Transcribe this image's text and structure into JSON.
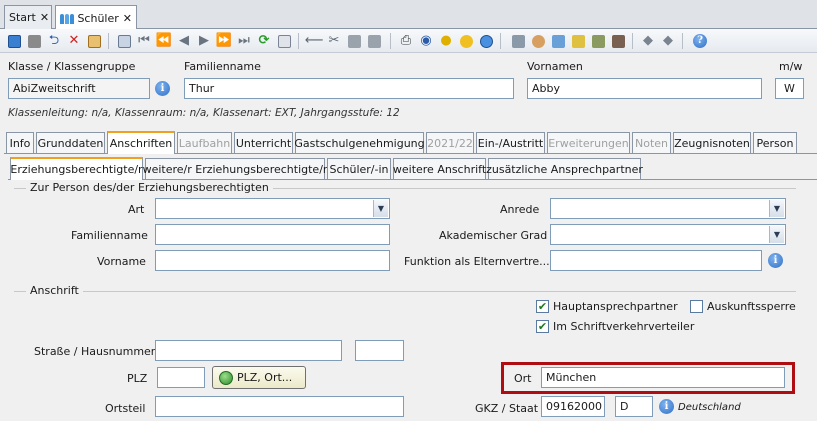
{
  "doc_tabs": [
    {
      "label": "Start",
      "active": false
    },
    {
      "label": "Schüler",
      "active": true
    }
  ],
  "header": {
    "klasse_label": "Klasse / Klassengruppe",
    "klasse_value": "AbiZweitschrift",
    "familienname_label": "Familienname",
    "familienname_value": "Thur",
    "vornamen_label": "Vornamen",
    "vornamen_value": "Abby",
    "mw_label": "m/w",
    "mw_value": "W",
    "info_line": "Klassenleitung: n/a, Klassenraum: n/a, Klassenart: EXT, Jahrgangsstufe: 12"
  },
  "main_tabs": [
    {
      "label": "Info",
      "state": "normal"
    },
    {
      "label": "Grunddaten",
      "state": "normal"
    },
    {
      "label": "Anschriften",
      "state": "active"
    },
    {
      "label": "Laufbahn",
      "state": "disabled"
    },
    {
      "label": "Unterricht",
      "state": "normal"
    },
    {
      "label": "Gastschulgenehmigung",
      "state": "normal"
    },
    {
      "label": "2021/22",
      "state": "disabled"
    },
    {
      "label": "Ein-/Austritt",
      "state": "normal"
    },
    {
      "label": "Erweiterungen",
      "state": "disabled"
    },
    {
      "label": "Noten",
      "state": "disabled"
    },
    {
      "label": "Zeugnisnoten",
      "state": "normal"
    },
    {
      "label": "Person",
      "state": "normal"
    }
  ],
  "sub_tabs": [
    {
      "label": "Erziehungsberechtigte/r",
      "active": true
    },
    {
      "label": "weitere/r Erziehungsberechtigte/r",
      "active": false
    },
    {
      "label": "Schüler/-in",
      "active": false
    },
    {
      "label": "weitere Anschrift",
      "active": false
    },
    {
      "label": "zusätzliche Ansprechpartner",
      "active": false
    }
  ],
  "person_group": {
    "title": "Zur Person des/der Erziehungsberechtigten",
    "art_label": "Art",
    "art_value": "",
    "anrede_label": "Anrede",
    "anrede_value": "",
    "familienname_label": "Familienname",
    "familienname_value": "",
    "akad_grad_label": "Akademischer Grad",
    "akad_grad_value": "",
    "vorname_label": "Vorname",
    "vorname_value": "",
    "funktion_label": "Funktion als Elternvertre...",
    "funktion_value": ""
  },
  "anschrift_group": {
    "title": "Anschrift",
    "hauptansprechpartner_label": "Hauptansprechpartner",
    "hauptansprechpartner_checked": true,
    "auskunftssperre_label": "Auskunftssperre",
    "auskunftssperre_checked": false,
    "schriftverkehr_label": "Im Schriftverkehrverteiler",
    "schriftverkehr_checked": true,
    "strasse_label": "Straße / Hausnummer",
    "strasse_value": "",
    "hausnummer_value": "",
    "plz_label": "PLZ",
    "plz_value": "",
    "plz_button_label": "PLZ, Ort...",
    "ort_label": "Ort",
    "ort_value": "München",
    "ortsteil_label": "Ortsteil",
    "ortsteil_value": "",
    "gkz_label": "GKZ / Staat",
    "gkz_value": "09162000",
    "staat_value": "D",
    "staat_name": "Deutschland"
  },
  "colors": {
    "highlight": "#b00d12",
    "active_tab_accent": "#f0a020"
  }
}
